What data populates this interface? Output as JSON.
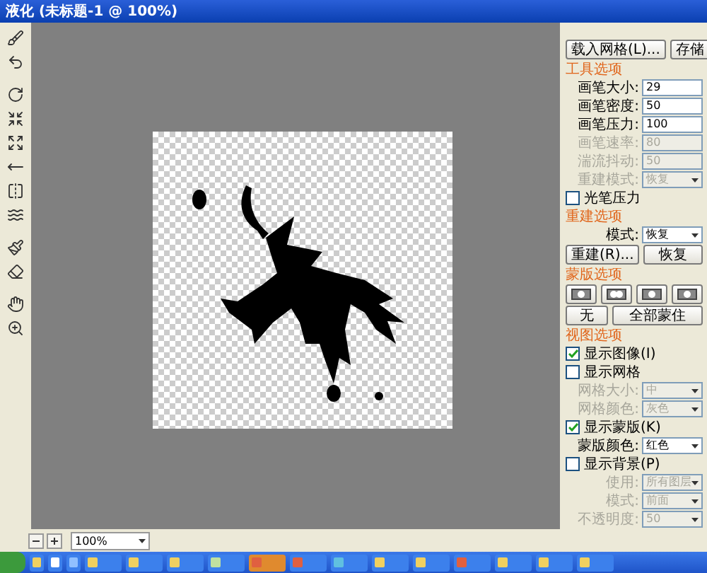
{
  "window": {
    "title": "液化 (未标题-1 @ 100%)"
  },
  "panel": {
    "top_buttons": [
      "载入网格(L)...",
      "存储"
    ],
    "tool_options": {
      "heading": "工具选项",
      "fields": [
        {
          "kind": "input",
          "label": "画笔大小:",
          "value": "29",
          "disabled": false
        },
        {
          "kind": "input",
          "label": "画笔密度:",
          "value": "50",
          "disabled": false
        },
        {
          "kind": "input",
          "label": "画笔压力:",
          "value": "100",
          "disabled": false
        },
        {
          "kind": "input",
          "label": "画笔速率:",
          "value": "80",
          "disabled": true
        },
        {
          "kind": "input",
          "label": "湍流抖动:",
          "value": "50",
          "disabled": true
        },
        {
          "kind": "select",
          "label": "重建模式:",
          "value": "恢复",
          "disabled": true
        }
      ],
      "stylus": {
        "label": "光笔压力",
        "checked": false
      }
    },
    "reconstruct": {
      "heading": "重建选项",
      "mode": {
        "kind": "select",
        "label": "模式:",
        "value": "恢复",
        "disabled": false
      },
      "buttons": [
        "重建(R)...",
        "恢复"
      ]
    },
    "mask": {
      "heading": "蒙版选项",
      "buttons": [
        "无",
        "全部蒙住"
      ]
    },
    "view": {
      "heading": "视图选项",
      "rows": [
        {
          "kind": "checkbox",
          "label": "显示图像(I)",
          "checked": true
        },
        {
          "kind": "checkbox",
          "label": "显示网格",
          "checked": false
        },
        {
          "kind": "select",
          "label": "网格大小:",
          "value": "中",
          "disabled": true
        },
        {
          "kind": "select",
          "label": "网格颜色:",
          "value": "灰色",
          "disabled": true
        },
        {
          "kind": "checkbox",
          "label": "显示蒙版(K)",
          "checked": true
        },
        {
          "kind": "select",
          "label": "蒙版颜色:",
          "value": "红色",
          "disabled": false
        },
        {
          "kind": "checkbox",
          "label": "显示背景(P)",
          "checked": false
        },
        {
          "kind": "select",
          "label": "使用:",
          "value": "所有图层",
          "disabled": true
        },
        {
          "kind": "select",
          "label": "模式:",
          "value": "前面",
          "disabled": true
        },
        {
          "kind": "select",
          "label": "不透明度:",
          "value": "50",
          "disabled": true
        }
      ]
    }
  },
  "status_bar": {
    "zoom": "100%"
  }
}
